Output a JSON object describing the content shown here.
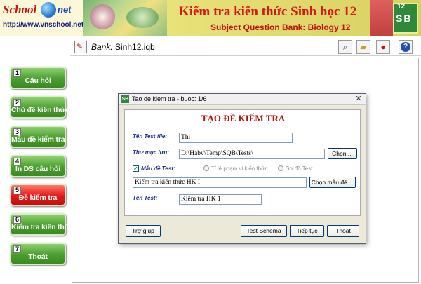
{
  "header": {
    "logo_word": "School",
    "logo_suffix": "net",
    "logo_url": "http://www.vnschool.net",
    "title": "Kiểm tra kiến thức Sinh học 12",
    "subtitle": "Subject Question Bank: Biology 12",
    "badge_grade": "12",
    "badge_letters": "SB"
  },
  "toolbar": {
    "bank_prefix": "Bank:",
    "bank_name": "Sinh12.iqb",
    "icons": [
      "search-icon",
      "folder-icon",
      "traffic-light-icon",
      "help-icon"
    ]
  },
  "sidebar": {
    "items": [
      {
        "num": "1",
        "label": "Câu hỏi",
        "active": false
      },
      {
        "num": "2",
        "label": "Chủ đề kiến thức",
        "active": false
      },
      {
        "num": "3",
        "label": "Mẫu đề kiểm tra",
        "active": false
      },
      {
        "num": "4",
        "label": "In DS câu hỏi",
        "active": false
      },
      {
        "num": "5",
        "label": "Đề kiểm tra",
        "active": true
      },
      {
        "num": "6",
        "label": "Kiểm tra kiến thức",
        "active": false
      },
      {
        "num": "7",
        "label": "Thoát",
        "active": false
      }
    ]
  },
  "dialog": {
    "title": "Tao de kiem tra - buoc: 1/6",
    "heading": "TẠO ĐỀ KIỂM TRA",
    "file_label": "Tên Test file:",
    "file_value": "Thi",
    "dir_label": "Thư mục lưu:",
    "dir_value": "D:\\Habv\\Temp\\SQB\\Tests\\",
    "browse_label": "Chọn ...",
    "template_label": "Mẫu đề Test:",
    "template_checked": true,
    "radio_scope_label": "Tỉ lệ phạm vi kiến thức",
    "radio_diagram_label": "Sơ đồ Test",
    "template_value": "Kiểm tra kiến thức HK I",
    "choose_template_label": "Chọn mẫu đề ...",
    "testname_label": "Tên Test:",
    "testname_value": "Kiểm tra HK 1",
    "btn_help": "Trợ giúp",
    "btn_schema": "Test Schema",
    "btn_next": "Tiếp tục",
    "btn_exit": "Thoát"
  },
  "colors": {
    "accent_red": "#d81818",
    "button_green": "#4a9e2e",
    "button_active": "#e21818"
  }
}
